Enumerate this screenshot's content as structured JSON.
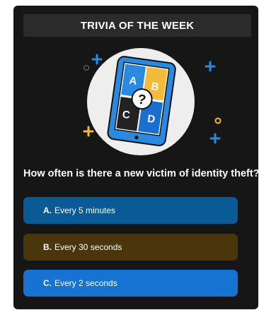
{
  "header": {
    "title": "TRIVIA OF THE WEEK"
  },
  "illustration": {
    "tiles": [
      "A",
      "B",
      "C",
      "D"
    ],
    "center_glyph": "?",
    "icons": [
      "tablet-quiz-icon",
      "plus-icon",
      "circle-icon"
    ],
    "colors": {
      "tablet": "#2a8ae0",
      "tile_a": "#2a8ae0",
      "tile_b": "#f2bb3a",
      "tile_c": "#222222",
      "tile_d": "#1a6ed0",
      "accent_yellow": "#f2bb3a",
      "accent_blue": "#2a8ae0"
    }
  },
  "question": {
    "text": "How often is there a new victim of identity theft?"
  },
  "answers": [
    {
      "letter": "A.",
      "text": "Every 5 minutes",
      "color": "#0a5a95"
    },
    {
      "letter": "B.",
      "text": "Every 30 seconds",
      "color": "#4a360a"
    },
    {
      "letter": "C.",
      "text": "Every 2 seconds",
      "color": "#1773d2"
    }
  ]
}
